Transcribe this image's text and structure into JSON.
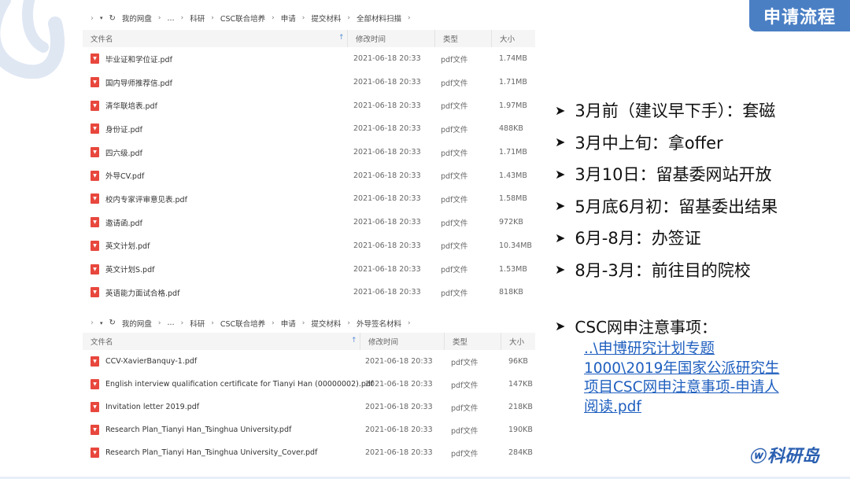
{
  "badge": "申请流程",
  "pane1": {
    "path": [
      "我的网盘",
      "...",
      "科研",
      "CSC联合培养",
      "申请",
      "提交材料",
      "全部材料扫描"
    ],
    "headers": {
      "name": "文件名",
      "date": "修改时间",
      "type": "类型",
      "size": "大小"
    },
    "rows": [
      {
        "name": "毕业证和学位证.pdf",
        "date": "2021-06-18 20:33",
        "type": "pdf文件",
        "size": "1.74MB"
      },
      {
        "name": "国内导师推荐信.pdf",
        "date": "2021-06-18 20:33",
        "type": "pdf文件",
        "size": "1.71MB"
      },
      {
        "name": "清华联培表.pdf",
        "date": "2021-06-18 20:33",
        "type": "pdf文件",
        "size": "1.97MB"
      },
      {
        "name": "身份证.pdf",
        "date": "2021-06-18 20:33",
        "type": "pdf文件",
        "size": "488KB"
      },
      {
        "name": "四六级.pdf",
        "date": "2021-06-18 20:33",
        "type": "pdf文件",
        "size": "1.71MB"
      },
      {
        "name": "外导CV.pdf",
        "date": "2021-06-18 20:33",
        "type": "pdf文件",
        "size": "1.43MB"
      },
      {
        "name": "校内专家评审意见表.pdf",
        "date": "2021-06-18 20:33",
        "type": "pdf文件",
        "size": "1.58MB"
      },
      {
        "name": "邀请函.pdf",
        "date": "2021-06-18 20:33",
        "type": "pdf文件",
        "size": "972KB"
      },
      {
        "name": "英文计划.pdf",
        "date": "2021-06-18 20:33",
        "type": "pdf文件",
        "size": "10.34MB"
      },
      {
        "name": "英文计划S.pdf",
        "date": "2021-06-18 20:33",
        "type": "pdf文件",
        "size": "1.53MB"
      },
      {
        "name": "英语能力面试合格.pdf",
        "date": "2021-06-18 20:33",
        "type": "pdf文件",
        "size": "818KB"
      }
    ]
  },
  "pane2": {
    "path": [
      "我的网盘",
      "...",
      "科研",
      "CSC联合培养",
      "申请",
      "提交材料",
      "外导签名材料"
    ],
    "headers": {
      "name": "文件名",
      "date": "修改时间",
      "type": "类型",
      "size": "大小"
    },
    "rows": [
      {
        "name": "CCV-XavierBanquy-1.pdf",
        "date": "2021-06-18 20:33",
        "type": "pdf文件",
        "size": "96KB"
      },
      {
        "name": "English interview qualification certificate for Tianyi Han (00000002).pdf",
        "date": "2021-06-18 20:33",
        "type": "pdf文件",
        "size": "147KB"
      },
      {
        "name": "Invitation letter 2019.pdf",
        "date": "2021-06-18 20:33",
        "type": "pdf文件",
        "size": "218KB"
      },
      {
        "name": "Research Plan_Tianyi Han_Tsinghua University.pdf",
        "date": "2021-06-18 20:33",
        "type": "pdf文件",
        "size": "190KB"
      },
      {
        "name": "Research Plan_Tianyi Han_Tsinghua University_Cover.pdf",
        "date": "2021-06-18 20:33",
        "type": "pdf文件",
        "size": "284KB"
      }
    ]
  },
  "steps": [
    "3月前（建议早下手）：套磁",
    "3月中上旬：拿offer",
    "3月10日：留基委网站开放",
    "5月底6月初：留基委出结果",
    "6月-8月：办签证",
    "8月-3月：前往目的院校"
  ],
  "note_title": "CSC网申注意事项：",
  "note_link": "..\\申博研究计划专题1000\\2019年国家公派研究生项目CSC网申注意事项-申请人阅读.pdf",
  "logo_text": "科研岛",
  "colors": {
    "badge": "#4a7fc4",
    "link": "#1f5fbf",
    "pdf_icon": "#e8473d"
  }
}
